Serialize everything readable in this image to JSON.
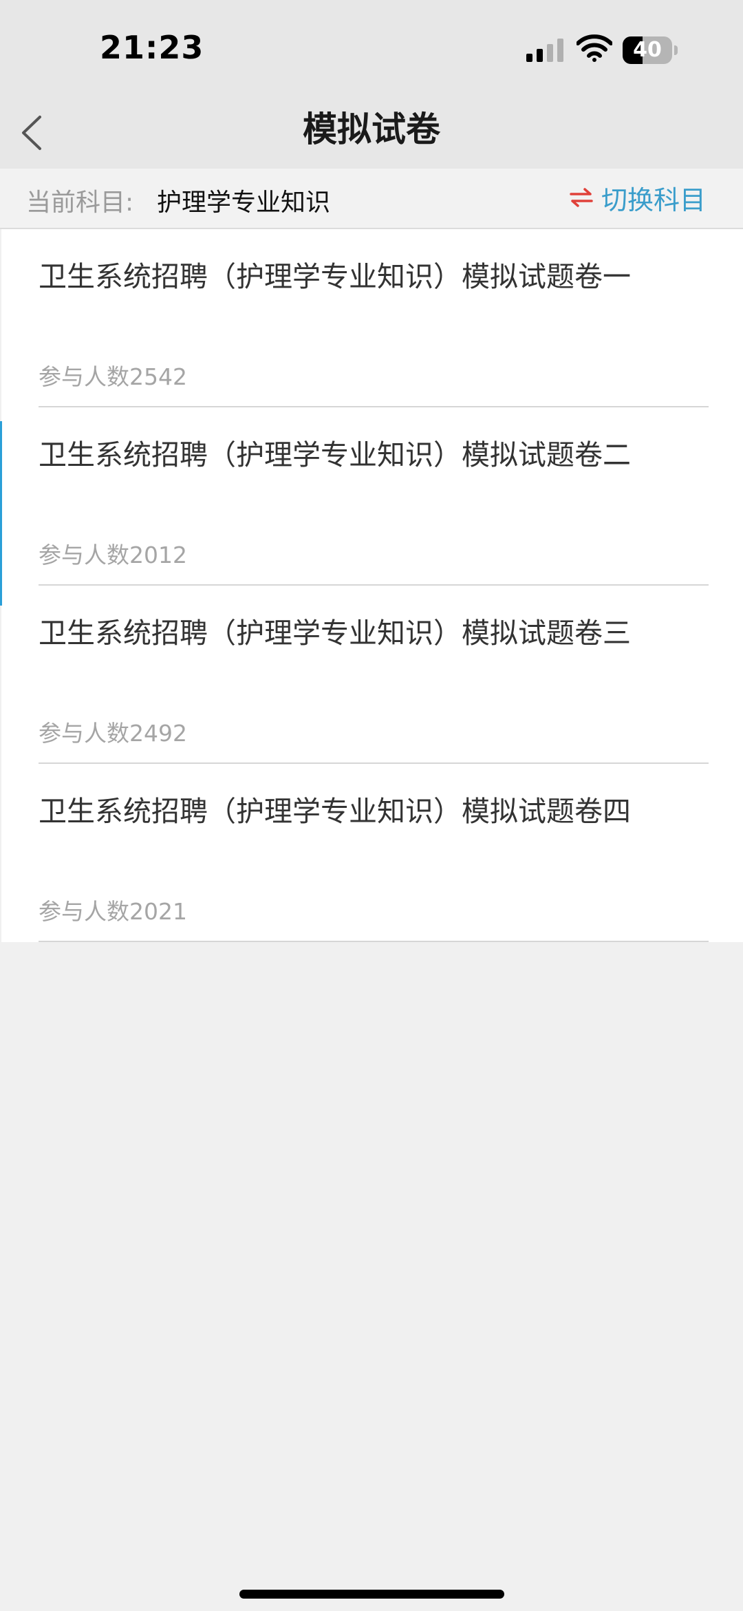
{
  "status_bar": {
    "time": "21:23",
    "battery_level": "40",
    "icons": [
      "signal-icon",
      "wifi-icon",
      "battery-icon"
    ]
  },
  "nav": {
    "title": "模拟试卷",
    "back_icon": "chevron-left-icon"
  },
  "subject": {
    "label": "当前科目:",
    "value": "护理学专业知识",
    "switch_label": "切换科目",
    "switch_icon": "swap-arrows-icon"
  },
  "papers": [
    {
      "title": "卫生系统招聘（护理学专业知识）模拟试题卷一",
      "participants": "参与人数2542"
    },
    {
      "title": "卫生系统招聘（护理学专业知识）模拟试题卷二",
      "participants": "参与人数2012"
    },
    {
      "title": "卫生系统招聘（护理学专业知识）模拟试题卷三",
      "participants": "参与人数2492"
    },
    {
      "title": "卫生系统招聘（护理学专业知识）模拟试题卷四",
      "participants": "参与人数2021"
    }
  ],
  "colors": {
    "accent": "#3a9dcb",
    "swap_icon": "#e0413a",
    "header_bg": "#e7e7e7",
    "page_bg": "#f0f0f0"
  }
}
